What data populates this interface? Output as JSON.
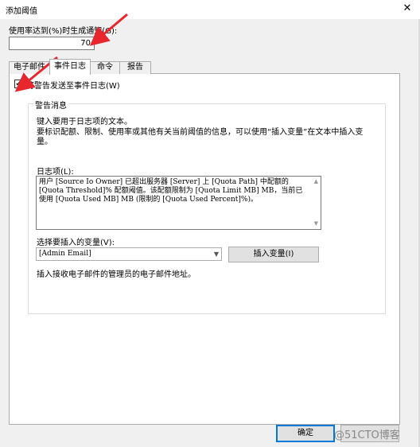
{
  "window": {
    "title": "添加阈值",
    "close_glyph": "✕"
  },
  "threshold": {
    "label": "使用率达到(%)时生成通知(G):",
    "value": "70"
  },
  "tabs": [
    {
      "label": "电子邮件"
    },
    {
      "label": "事件日志"
    },
    {
      "label": "命令"
    },
    {
      "label": "报告"
    }
  ],
  "event_log": {
    "checkbox_label": "将警告发送至事件日志(W)",
    "checkbox_checked": true,
    "check_glyph": "✓",
    "group_title": "警告消息",
    "desc1": "键入要用于日志项的文本。",
    "desc2": "要标识配额、限制、使用率或其他有关当前阈值的信息，可以使用“插入变量”在文本中插入变量。",
    "log_label": "日志项(L):",
    "log_text": "用户 [Source Io Owner] 已超出服务器 [Server] 上 [Quota Path] 中配额的 [Quota Threshold]% 配额阈值。该配额限制为 [Quota Limit MB] MB，当前已使用 [Quota Used MB] MB (限制的 [Quota Used Percent]%)。",
    "var_label": "选择要插入的变量(V):",
    "var_selected": "[Admin Email]",
    "insert_button": "插入变量(I)",
    "var_desc": "插入接收电子邮件的管理员的电子邮件地址。"
  },
  "footer": {
    "ok_label": "确定"
  },
  "watermark": "@51CTO博客",
  "colors": {
    "annotation_arrow": "#e8262d",
    "focus_border": "#0078d7"
  }
}
